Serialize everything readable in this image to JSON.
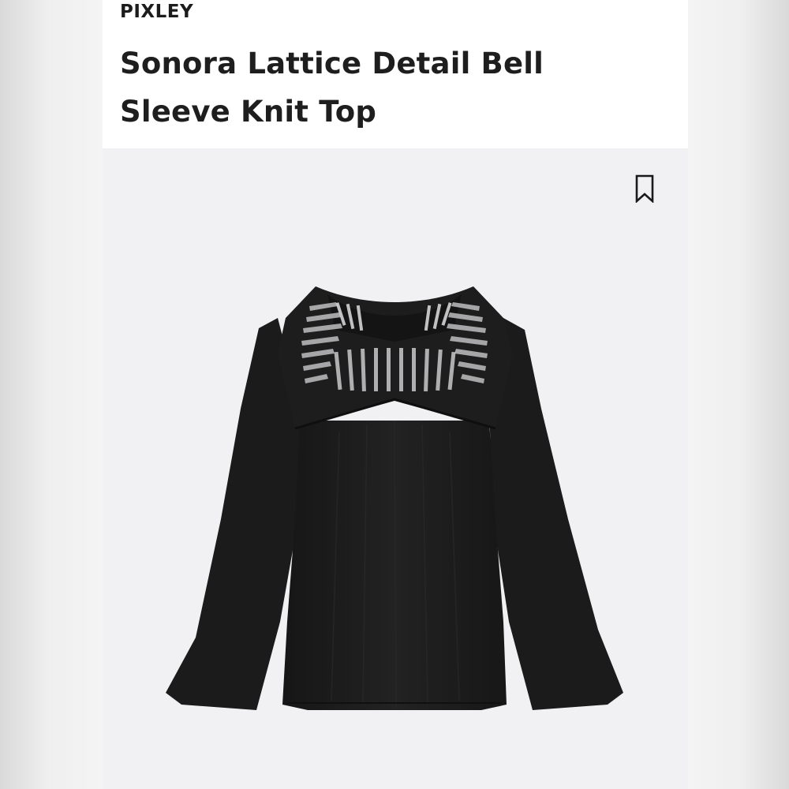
{
  "product": {
    "brand": "PIXLEY",
    "title": "Sonora Lattice Detail Bell Sleeve Knit Top"
  },
  "icons": {
    "bookmark": "bookmark-icon"
  },
  "colors": {
    "header_bg": "#ffffff",
    "photo_bg": "#f1f1f3",
    "text": "#1e1e1e",
    "garment": "#1c1c1c"
  }
}
